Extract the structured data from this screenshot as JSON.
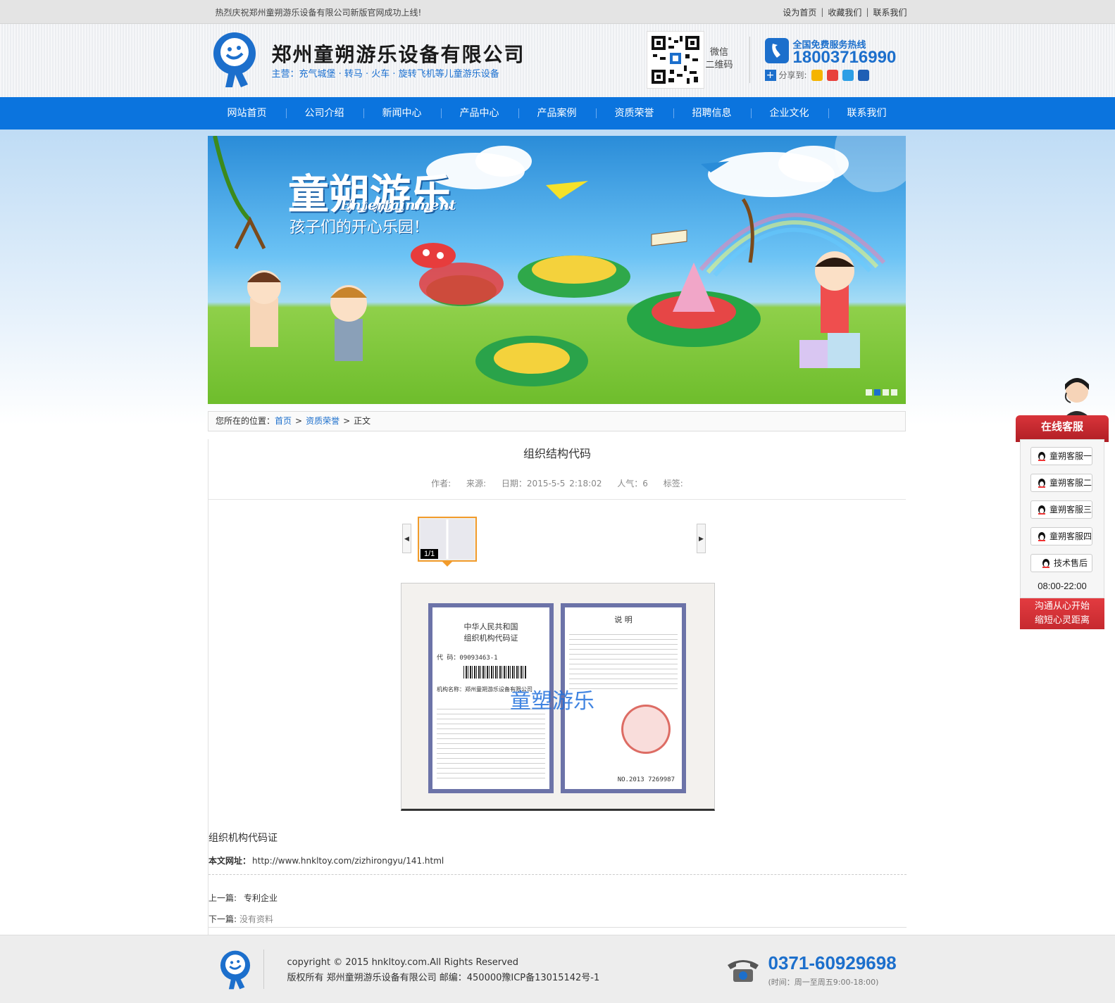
{
  "topbar": {
    "notice": "热烈庆祝郑州童朔游乐设备有限公司新版官网成功上线!",
    "links": [
      "设为首页",
      "收藏我们",
      "联系我们"
    ]
  },
  "header": {
    "company_name": "郑州童朔游乐设备有限公司",
    "slogan": "主营：充气城堡 · 转马 · 火车 · 旋转飞机等儿童游乐设备",
    "qr_label_1": "微信",
    "qr_label_2": "二维码",
    "hotline_title": "全国免费服务热线",
    "hotline_number": "18003716990",
    "share_label": "分享到:"
  },
  "nav": {
    "items": [
      "网站首页",
      "公司介绍",
      "新闻中心",
      "产品中心",
      "产品案例",
      "资质荣誉",
      "招聘信息",
      "企业文化",
      "联系我们"
    ]
  },
  "banner": {
    "title_cn": "童朔游乐",
    "title_en": "Entertainment",
    "subtitle": "孩子们的开心乐园！"
  },
  "breadcrumb": {
    "prefix": "您所在的位置：",
    "home": "首页",
    "category": "资质荣誉",
    "current": "正文"
  },
  "article": {
    "title": "组织结构代码",
    "author_label": "作者:",
    "source_label": "来源:",
    "date": "日期：2015-5-5 2:18:02",
    "views": "人气：6",
    "tags_label": "标签:",
    "gallery_count": "1/1",
    "cert_left_heading_1": "中华人民共和国",
    "cert_left_heading_2": "组织机构代码证",
    "cert_code": "代    码：09093463-1",
    "cert_org": "机构名称：郑州童朔游乐设备有限公司",
    "cert_no": "NO.2013 7269987",
    "cert_right_heading": "说    明",
    "watermark": "童塑游乐",
    "caption": "组织机构代码证",
    "url_label": "本文网址：",
    "url": "http://www.hnkltoy.com/zizhirongyu/141.html",
    "prev_label": "上一篇:",
    "prev_value": "专利企业",
    "next_label": "下一篇:",
    "next_value": "没有资料"
  },
  "footer": {
    "copyright": "copyright © 2015 hnkltoy.com.All Rights Reserved",
    "company_line": "版权所有 郑州童朔游乐设备有限公司 邮编：450000豫ICP备13015142号-1",
    "phone": "0371-60929698",
    "hours": "(时间：周一至周五9:00-18:00)"
  },
  "customer_service": {
    "title": "在线客服",
    "agents": [
      "童朔客服一",
      "童朔客服二",
      "童朔客服三",
      "童朔客服四",
      "技术售后"
    ],
    "hours": "08:00-22:00",
    "slogan_1": "沟通从心开始",
    "slogan_2": "缩短心灵距离"
  },
  "colors": {
    "brand_blue": "#0b74de",
    "accent_orange": "#f29b2a",
    "cs_red": "#c62a2f"
  }
}
